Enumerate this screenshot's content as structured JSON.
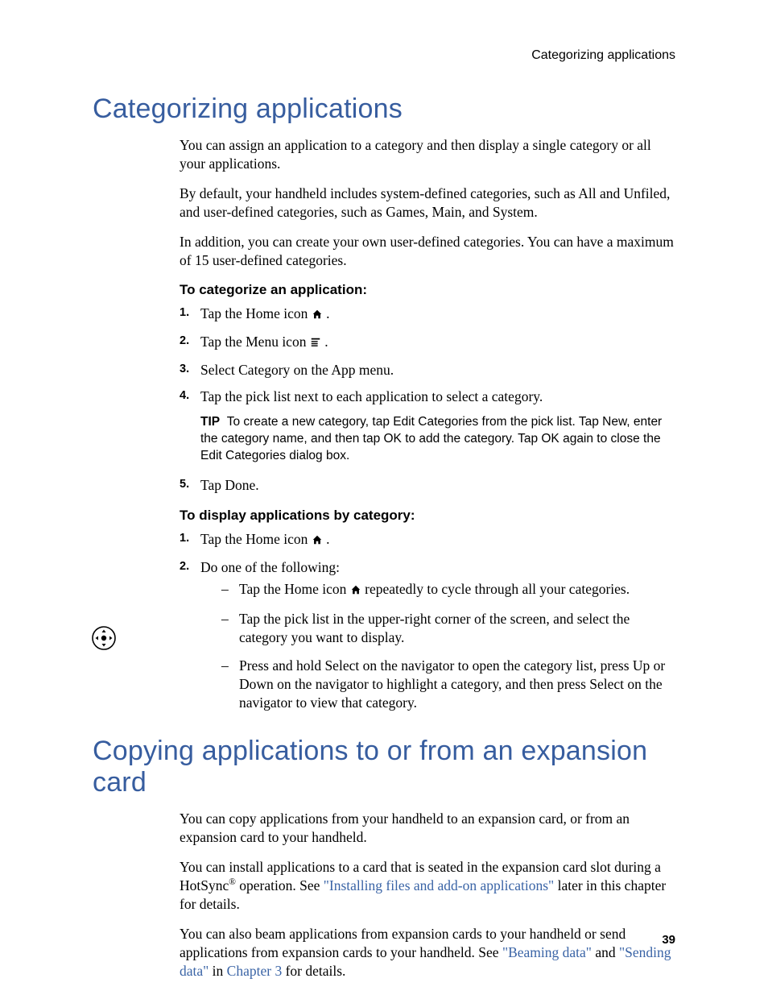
{
  "running_header": "Categorizing applications",
  "page_number": "39",
  "icons": {
    "home": "home-icon",
    "menu": "menu-icon",
    "navigator": "navigator-icon"
  },
  "section1": {
    "title": "Categorizing applications",
    "paras": [
      "You can assign an application to a category and then display a single category or all your applications.",
      "By default, your handheld includes system-defined categories, such as All and Unfiled, and user-defined categories, such as Games, Main, and System.",
      "In addition, you can create your own user-defined categories. You can have a maximum of 15 user-defined categories."
    ],
    "proc1_title": "To categorize an application:",
    "proc1_steps": {
      "s1_pre": "Tap the Home icon ",
      "s1_post": ".",
      "s2_pre": "Tap the Menu icon ",
      "s2_post": ".",
      "s3": "Select Category on the App menu.",
      "s4": "Tap the pick list next to each application to select a category.",
      "s5": "Tap Done."
    },
    "markers": {
      "m1": "1.",
      "m2": "2.",
      "m3": "3.",
      "m4": "4.",
      "m5": "5."
    },
    "tip_label": "TIP",
    "tip_text": "To create a new category, tap Edit Categories from the pick list. Tap New, enter the category name, and then tap OK to add the category. Tap OK again to close the Edit Categories dialog box.",
    "proc2_title": "To display applications by category:",
    "proc2_steps": {
      "s1_pre": "Tap the Home icon ",
      "s1_post": ".",
      "s2": "Do one of the following:"
    },
    "proc2_bullets": {
      "b1_pre": "Tap the Home icon ",
      "b1_post": " repeatedly to cycle through all your categories.",
      "b2": "Tap the pick list in the upper-right corner of the screen, and select the category you want to display.",
      "b3": "Press and hold Select on the navigator to open the category list, press Up or Down on the navigator to highlight a category, and then press Select on the navigator to view that category."
    }
  },
  "section2": {
    "title": "Copying applications to or from an expansion card",
    "p1": "You can copy applications from your handheld to an expansion card, or from an expansion card to your handheld.",
    "p2_pre": "You can install applications to a card that is seated in the expansion card slot during a HotSync",
    "p2_sup": "®",
    "p2_mid": " operation. See ",
    "p2_link": "\"Installing files and add-on applications\"",
    "p2_post": " later in this chapter for details.",
    "p3_pre": "You can also beam applications from expansion cards to your handheld or send applications from expansion cards to your handheld. See ",
    "p3_link1": "\"Beaming data\"",
    "p3_mid1": " and ",
    "p3_link2": "\"Sending data\"",
    "p3_mid2": " in ",
    "p3_link3": "Chapter 3",
    "p3_post": " for details."
  }
}
